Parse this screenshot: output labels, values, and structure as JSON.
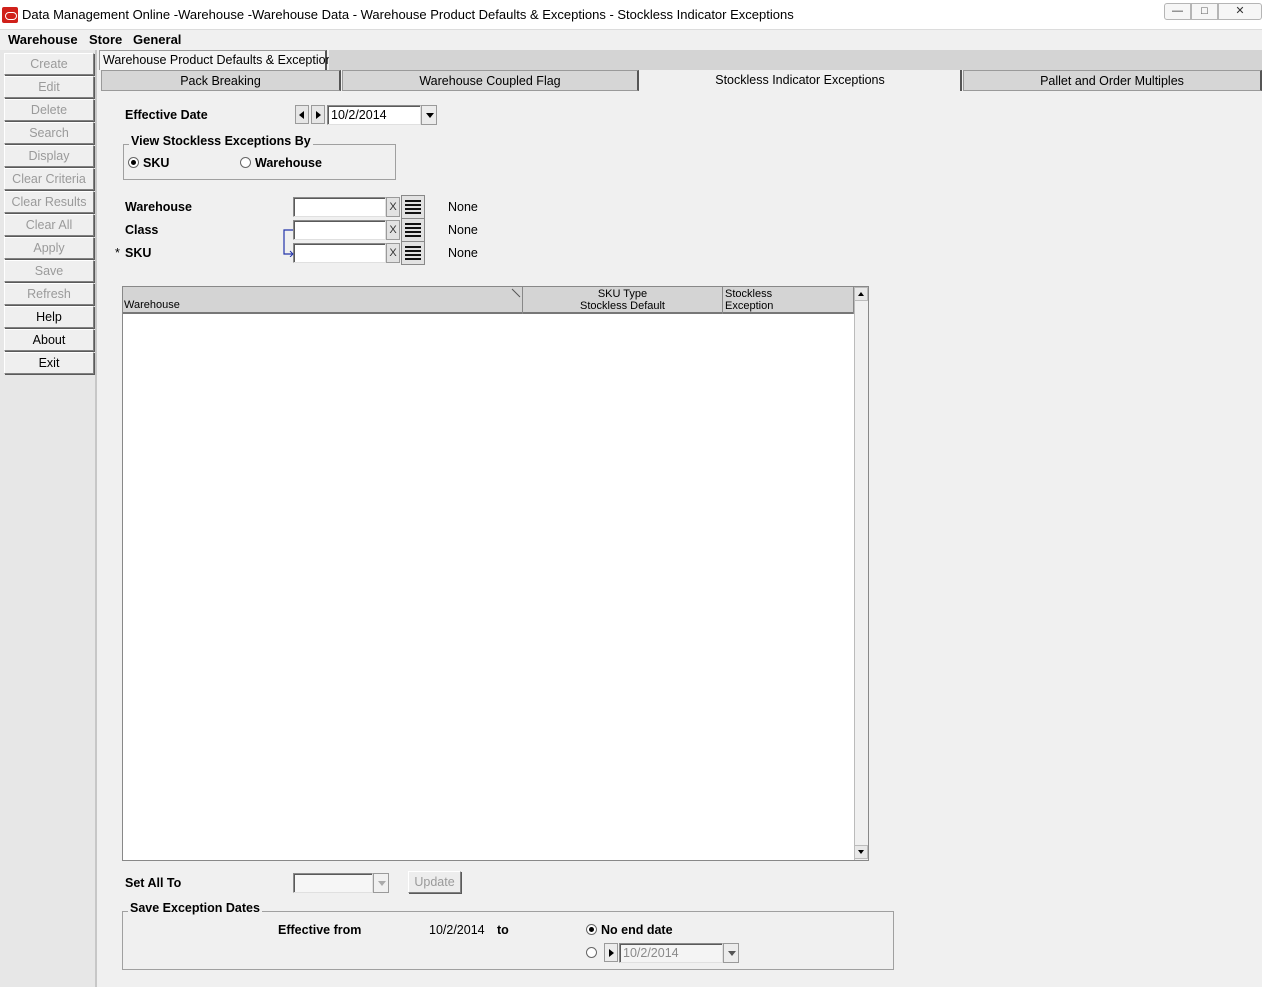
{
  "window": {
    "title": "Data Management Online -Warehouse -Warehouse Data - Warehouse Product Defaults & Exceptions - Stockless Indicator Exceptions"
  },
  "menu": [
    "Warehouse",
    "Store",
    "General"
  ],
  "sidebar": {
    "buttons": [
      {
        "label": "Create",
        "enabled": false
      },
      {
        "label": "Edit",
        "enabled": false
      },
      {
        "label": "Delete",
        "enabled": false
      },
      {
        "label": "Search",
        "enabled": false
      },
      {
        "label": "Display",
        "enabled": false
      },
      {
        "label": "Clear Criteria",
        "enabled": false
      },
      {
        "label": "Clear Results",
        "enabled": false
      },
      {
        "label": "Clear All",
        "enabled": false
      },
      {
        "label": "Apply",
        "enabled": false
      },
      {
        "label": "Save",
        "enabled": false
      },
      {
        "label": "Refresh",
        "enabled": false
      },
      {
        "label": "Help",
        "enabled": true
      },
      {
        "label": "About",
        "enabled": true
      },
      {
        "label": "Exit",
        "enabled": true
      }
    ]
  },
  "outer_tab": "Warehouse Product Defaults & Exceptions",
  "tabs": [
    {
      "label": "Pack Breaking",
      "active": false
    },
    {
      "label": "Warehouse Coupled Flag",
      "active": false
    },
    {
      "label": "Stockless Indicator Exceptions",
      "active": true
    },
    {
      "label": "Pallet and Order Multiples",
      "active": false
    }
  ],
  "effective_date": {
    "label": "Effective Date",
    "value": "10/2/2014"
  },
  "view_by": {
    "title": "View Stockless Exceptions By",
    "options": [
      "SKU",
      "Warehouse"
    ],
    "selected": "SKU"
  },
  "criteria": {
    "warehouse": {
      "label": "Warehouse",
      "value": "",
      "description": "None",
      "clear": "X"
    },
    "class": {
      "label": "Class",
      "value": "",
      "description": "None",
      "clear": "X"
    },
    "sku": {
      "label": "SKU",
      "required_mark": "*",
      "value": "",
      "description": "None",
      "clear": "X"
    }
  },
  "grid": {
    "columns": [
      {
        "label": "Warehouse"
      },
      {
        "label_line1": "SKU Type",
        "label_line2": "Stockless Default"
      },
      {
        "label_line1": "Stockless",
        "label_line2": "Exception"
      }
    ],
    "rows": []
  },
  "set_all": {
    "label": "Set All To",
    "value": "",
    "update_label": "Update"
  },
  "save_dates": {
    "title": "Save Exception Dates",
    "effective_from_label": "Effective from",
    "effective_from_value": "10/2/2014",
    "to_label": "to",
    "no_end_date_label": "No end date",
    "no_end_date_selected": true,
    "end_date_value": "10/2/2014"
  }
}
